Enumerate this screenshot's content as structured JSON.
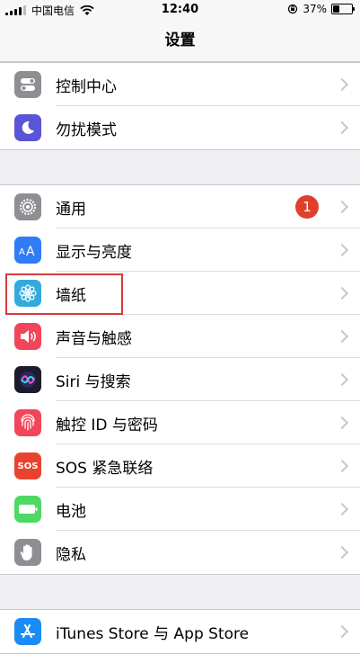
{
  "status_bar": {
    "carrier": "中国电信",
    "time": "12:40",
    "battery_percent": "37%",
    "battery_level": 0.37
  },
  "nav": {
    "title": "设置"
  },
  "groups": [
    {
      "rows": [
        {
          "label": "控制中心",
          "icon": "control-center-icon",
          "color": "#8e8e93"
        },
        {
          "label": "勿扰模式",
          "icon": "moon-icon",
          "color": "#5856d6"
        }
      ]
    },
    {
      "rows": [
        {
          "label": "通用",
          "icon": "gear-icon",
          "color": "#8e8e93",
          "badge": "1"
        },
        {
          "label": "显示与亮度",
          "icon": "text-size-icon",
          "color": "#2f7cf6"
        },
        {
          "label": "墙纸",
          "icon": "flower-icon",
          "color": "#34aadc"
        },
        {
          "label": "声音与触感",
          "icon": "speaker-icon",
          "color": "#f2455a"
        },
        {
          "label": "Siri 与搜索",
          "icon": "siri-icon",
          "color": "#1c1c2e"
        },
        {
          "label": "触控 ID 与密码",
          "icon": "fingerprint-icon",
          "color": "#f2455a"
        },
        {
          "label": "SOS 紧急联络",
          "icon": "sos-icon",
          "color": "#e8432e",
          "icon_text": "SOS"
        },
        {
          "label": "电池",
          "icon": "battery-icon",
          "color": "#4cd964"
        },
        {
          "label": "隐私",
          "icon": "hand-icon",
          "color": "#8e8e93"
        }
      ]
    },
    {
      "rows": [
        {
          "label": "iTunes Store 与 App Store",
          "icon": "app-store-icon",
          "color": "#1a8cf7"
        }
      ]
    }
  ],
  "highlight_color": "#d63b3b"
}
